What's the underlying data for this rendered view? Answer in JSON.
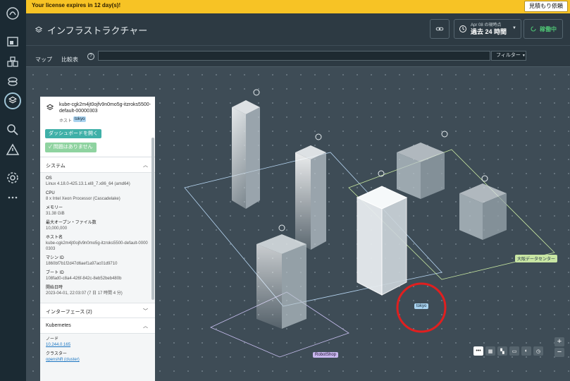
{
  "banner": {
    "text": "Your license expires in 12 day(s)!",
    "quote_button": "見積もり依頼"
  },
  "header": {
    "title": "インフラストラクチャー",
    "time_sub": "Apr 08 の現時点",
    "time_main": "過去 24 時間",
    "status": "稼働中"
  },
  "tabs": [
    {
      "label": "マップ"
    },
    {
      "label": "比較表"
    }
  ],
  "search": {
    "value": "",
    "placeholder": ""
  },
  "filter": {
    "label": "フィルター"
  },
  "map": {
    "zones": {
      "osaka": "大阪データセンター",
      "tokyo": "tokyo",
      "robot": "RobotShop"
    }
  },
  "panel": {
    "host": "kube-cgk2m4jt0ojfv9n0mo5g-itzroks5500-default-00000303",
    "host_label": "ホスト",
    "host_tag": "tokyo",
    "dashboard_button": "ダッシュボードを開く",
    "no_problems_button": "問題はありません",
    "system_title": "システム",
    "fields": [
      {
        "k": "OS",
        "v": "Linux 4.18.0-425.13.1.el8_7.x86_64 (amd64)"
      },
      {
        "k": "CPU",
        "v": "8 x Intel Xeon Processor (Cascadelake)"
      },
      {
        "k": "メモリー",
        "v": "31.38 GiB"
      },
      {
        "k": "最大オープン・ファイル数",
        "v": "10,000,000"
      },
      {
        "k": "ホスト名",
        "v": "kube-cgk2m4jt0ojfv9n0mo5g-itzroks5500-default-00000303"
      },
      {
        "k": "マシン ID",
        "v": "1860bf7b1f2d47d6aef1a97ac01d9710"
      },
      {
        "k": "ブート ID",
        "v": "108fad0-c8a4-426f-842c-8eb52beb480b"
      },
      {
        "k": "開始日時",
        "v": "2023-04-01, 22:03:07 (7 日 17 時間 4 分)"
      }
    ],
    "interfaces_title": "インターフェース (2)",
    "kubernetes_title": "Kubernetes",
    "node_label": "ノード",
    "node_value": "10.244.0.165",
    "cluster_label": "クラスター",
    "cluster_value": "openshift (cluster)"
  }
}
